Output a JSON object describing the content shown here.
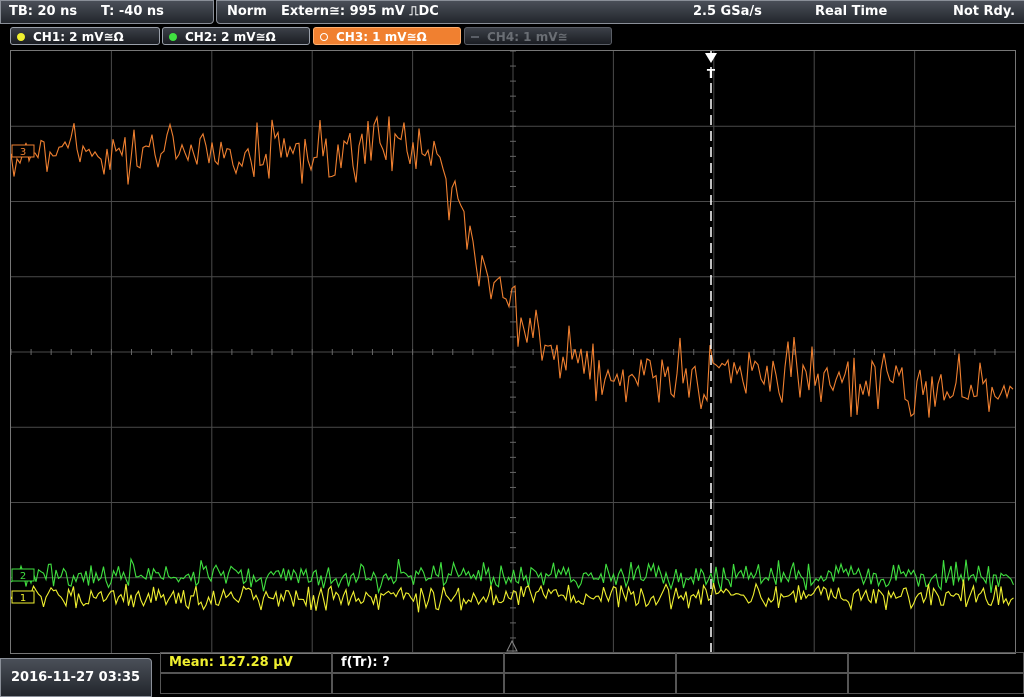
{
  "timebase": {
    "tb_label": "TB: 20 ns",
    "t_label": "T: -40 ns"
  },
  "status": {
    "mode": "Norm",
    "trigger": "Extern≅: 995 mV ⎍DC",
    "sample_rate": "2.5 GSa/s",
    "acq_mode": "Real Time",
    "ready": "Not Rdy."
  },
  "channels": [
    {
      "label": "CH1: 2 mV≅Ω",
      "color": "#f0f030",
      "active": true
    },
    {
      "label": "CH2: 2 mV≅Ω",
      "color": "#40e040",
      "active": true
    },
    {
      "label": "CH3: 1 mV≅Ω",
      "color": "#f08030",
      "active": true,
      "selected": true
    },
    {
      "label": "CH4: 1 mV≅",
      "color": "#6a6e74",
      "active": false
    }
  ],
  "measurements": {
    "mean": "Mean: 127.28 µV",
    "ftr": "f(Tr): ?"
  },
  "datetime": "2016-11-27 03:35",
  "markers": {
    "ch3_ref": "3",
    "ch2_ref": "2",
    "ch1_ref": "1",
    "trigger": "T"
  },
  "colors": {
    "ch1": "#f0f030",
    "ch2": "#40e040",
    "ch3": "#f08030",
    "grid": "#4a4a4a"
  }
}
